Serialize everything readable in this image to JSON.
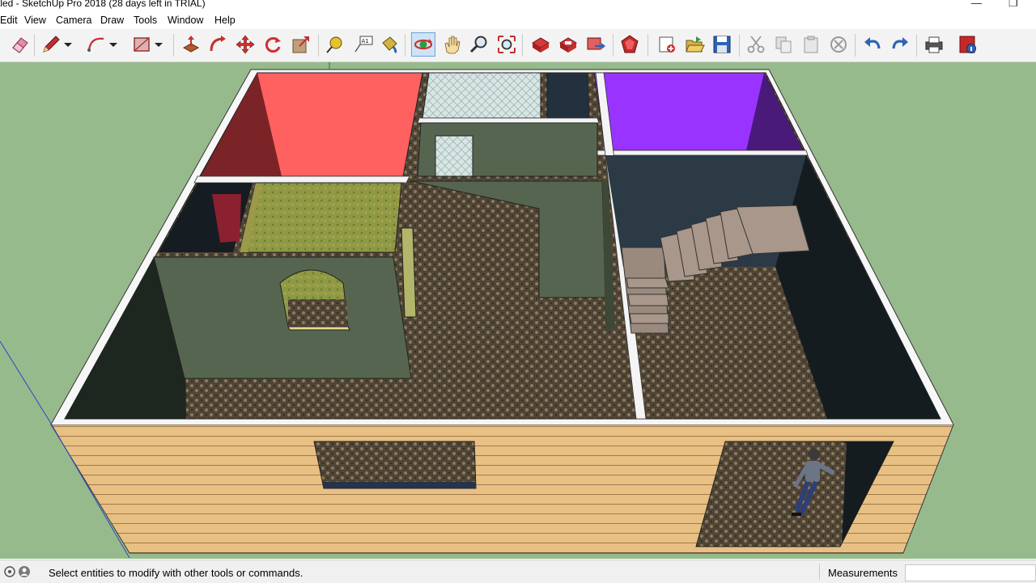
{
  "window": {
    "title": "tled - SketchUp Pro 2018 (28 days left in TRIAL)",
    "controls": [
      "minimize-icon",
      "restore-icon"
    ]
  },
  "menu": {
    "items": [
      "Edit",
      "View",
      "Camera",
      "Draw",
      "Tools",
      "Window",
      "Help"
    ]
  },
  "toolbar": {
    "tools": [
      "eraser-icon",
      "pencil-icon",
      "dropdown-arrow-icon",
      "arc-icon",
      "dropdown-arrow-icon",
      "rectangle-icon",
      "dropdown-arrow-icon",
      "push-pull-icon",
      "follow-me-icon",
      "move-icon",
      "rotate-icon",
      "scale-icon",
      "tape-measure-icon",
      "text-icon",
      "paint-bucket-icon",
      "orbit-icon",
      "pan-icon",
      "zoom-icon",
      "zoom-extents-icon",
      "3d-warehouse-icon",
      "extension-warehouse-icon",
      "share-model-icon",
      "extension-manager-icon",
      "new-icon",
      "open-icon",
      "save-icon",
      "cut-icon",
      "copy-icon",
      "paste-icon",
      "erase-icon",
      "undo-icon",
      "redo-icon",
      "print-icon",
      "model-info-icon"
    ],
    "active_tool": "orbit-icon"
  },
  "status": {
    "message": "Select entities to modify with other tools or commands.",
    "measurements_label": "Measurements",
    "measurements_value": ""
  },
  "colors": {
    "viewport_bg": "#97ba8c",
    "red_floor": "#ff6060",
    "purple_floor": "#9933ff",
    "wall_siding": "#e8c084",
    "wall_interior": "#56654f"
  }
}
